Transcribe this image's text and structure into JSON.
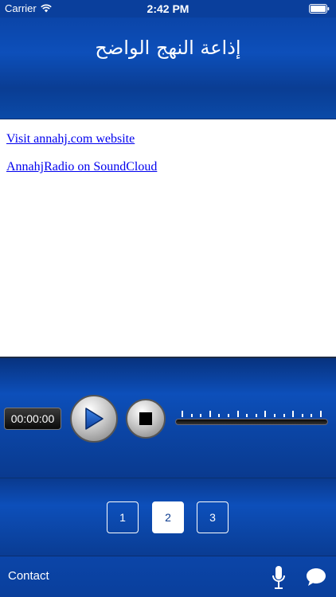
{
  "status_bar": {
    "carrier": "Carrier",
    "time": "2:42 PM",
    "wifi_icon": "wifi-icon",
    "battery_icon": "battery-icon"
  },
  "header": {
    "title": "إذاعة النهج الواضح"
  },
  "links": [
    {
      "text": "Visit annahj.com website"
    },
    {
      "text": "AnnahjRadio on SoundCloud"
    }
  ],
  "player": {
    "time": "00:00:00",
    "play_icon": "play-icon",
    "stop_icon": "stop-icon"
  },
  "pager": {
    "pages": [
      "1",
      "2",
      "3"
    ],
    "active_page": "2"
  },
  "bottom_bar": {
    "contact_label": "Contact",
    "mic_icon": "microphone-icon",
    "chat_icon": "chat-bubble-icon"
  },
  "colors": {
    "bar_blue": "#0b45a8",
    "link_blue": "#0000ee",
    "white": "#ffffff"
  }
}
